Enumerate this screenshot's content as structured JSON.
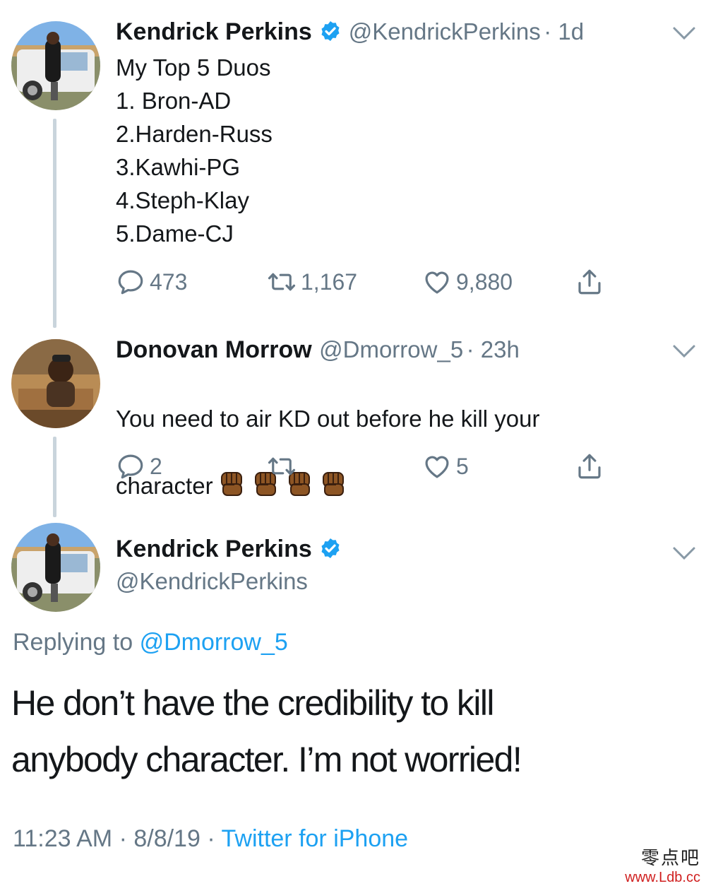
{
  "tweet1": {
    "name": "Kendrick Perkins",
    "handle": "@KendrickPerkins",
    "time": "· 1d",
    "text": "My Top 5 Duos\n1. Bron-AD\n2.Harden-Russ\n3.Kawhi-PG\n4.Steph-Klay\n5.Dame-CJ",
    "replies": "473",
    "retweets": "1,167",
    "likes": "9,880"
  },
  "tweet2": {
    "name": "Donovan Morrow",
    "handle": "@Dmorrow_5",
    "time": "· 23h",
    "text_line1": "You need to air KD out before he kill your",
    "text_line2": "character",
    "emoji_name": "raised-fist-medium-dark-skin",
    "replies": "2",
    "retweets": "",
    "likes": "5"
  },
  "tweet3": {
    "name": "Kendrick Perkins",
    "handle": "@KendrickPerkins",
    "replying_prefix": "Replying to",
    "replying_to": "@Dmorrow_5",
    "text_line1": "He don’t have the credibility to kill",
    "text_line2": "anybody character. I’m not worried!",
    "timestamp": "11:23 AM · 8/8/19 ·",
    "source": "Twitter for iPhone"
  },
  "watermark": {
    "line1": "零点吧",
    "line2": "www.Ldb.cc"
  },
  "colors": {
    "accent": "#1da1f2",
    "secondary_text": "#657786",
    "thread_line": "#c9d4dc",
    "emoji_skin": "#8d5524",
    "watermark_red": "#d02020"
  }
}
